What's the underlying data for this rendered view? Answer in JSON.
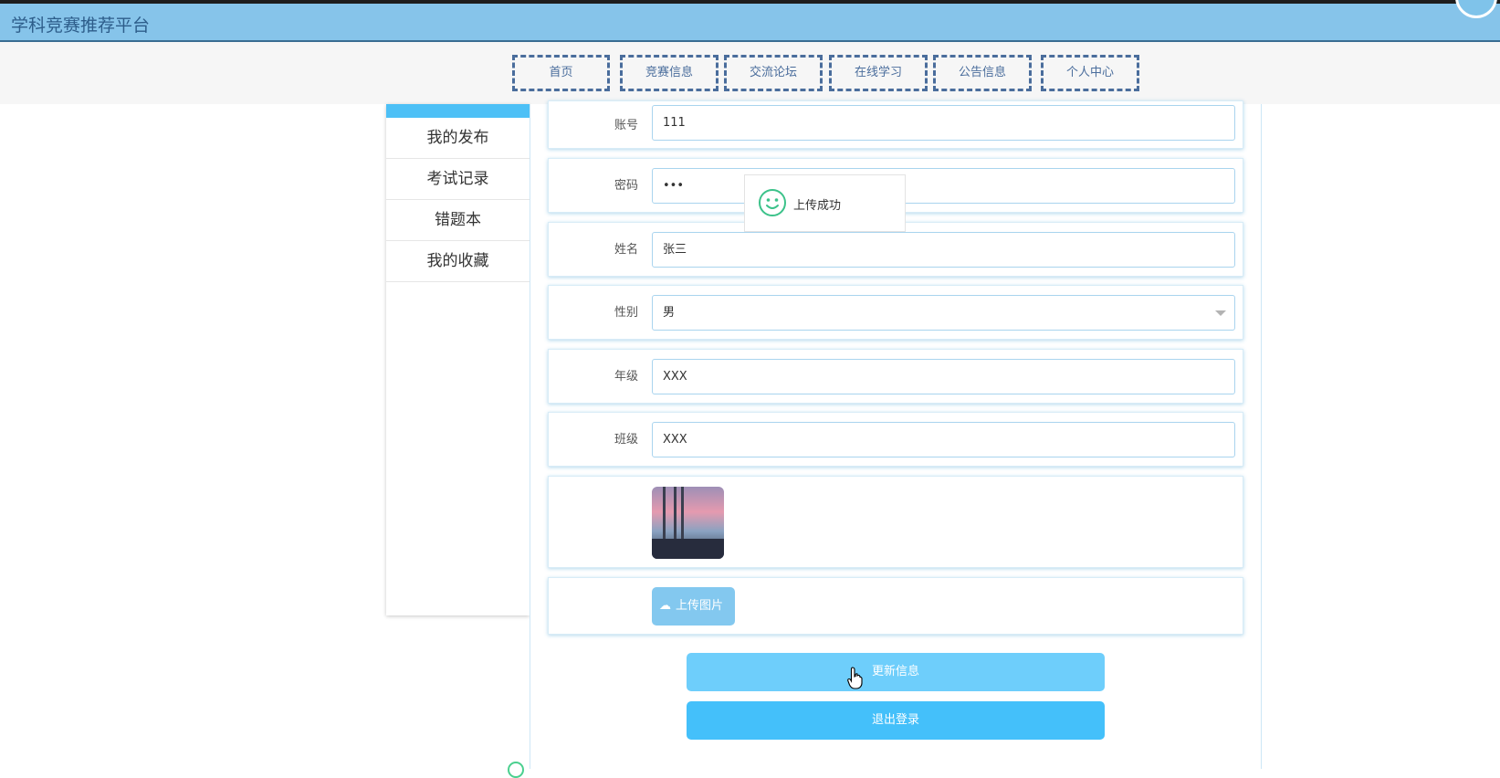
{
  "header": {
    "title": "学科竞赛推荐平台"
  },
  "nav": {
    "items": [
      {
        "label": "首页"
      },
      {
        "label": "竞赛信息"
      },
      {
        "label": "交流论坛"
      },
      {
        "label": "在线学习"
      },
      {
        "label": "公告信息"
      },
      {
        "label": "个人中心"
      }
    ]
  },
  "sidebar": {
    "items": [
      {
        "label": "我的发布"
      },
      {
        "label": "考试记录"
      },
      {
        "label": "错题本"
      },
      {
        "label": "我的收藏"
      }
    ]
  },
  "form": {
    "account": {
      "label": "账号",
      "value": "111"
    },
    "password": {
      "label": "密码",
      "value": "•••"
    },
    "name": {
      "label": "姓名",
      "value": "张三"
    },
    "gender": {
      "label": "性别",
      "value": "男"
    },
    "grade": {
      "label": "年级",
      "value": "XXX"
    },
    "class": {
      "label": "班级",
      "value": "XXX"
    },
    "upload_label": "上传图片"
  },
  "buttons": {
    "update": "更新信息",
    "logout": "退出登录"
  },
  "toast": {
    "message": "上传成功"
  },
  "colors": {
    "header_bg": "#86c4ea",
    "nav_border": "#4a6d9c",
    "accent": "#44c0fa",
    "update_button": "#6ecefb",
    "success": "#3cc28a"
  },
  "icons": {
    "upload": "cloud-upload-icon",
    "toast": "smile-icon",
    "cursor": "hand-pointer-icon",
    "select": "chevron-down-icon"
  }
}
